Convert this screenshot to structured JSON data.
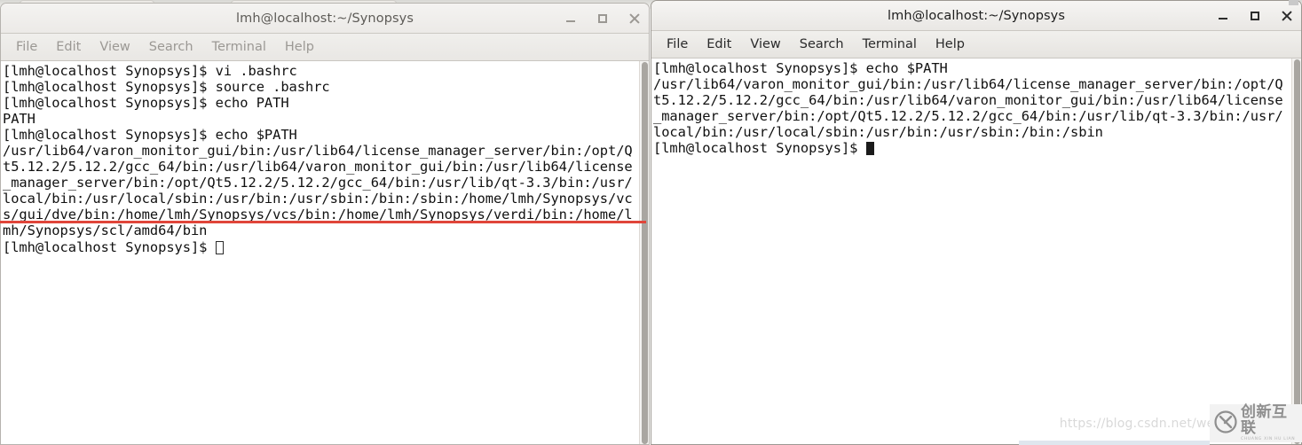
{
  "background_tabs": [
    {
      "label": ""
    },
    {
      "label": ""
    },
    {
      "label": ""
    },
    {
      "label": ""
    }
  ],
  "windows": {
    "left": {
      "title": "lmh@localhost:~/Synopsys",
      "active": false,
      "menu": [
        "File",
        "Edit",
        "View",
        "Search",
        "Terminal",
        "Help"
      ],
      "window_buttons": {
        "minimize": "minimize-icon",
        "maximize": "maximize-icon",
        "close": "close-icon"
      },
      "terminal_text": "[lmh@localhost Synopsys]$ vi .bashrc\n[lmh@localhost Synopsys]$ source .bashrc\n[lmh@localhost Synopsys]$ echo PATH\nPATH\n[lmh@localhost Synopsys]$ echo $PATH\n/usr/lib64/varon_monitor_gui/bin:/usr/lib64/license_manager_server/bin:/opt/Qt5.12.2/5.12.2/gcc_64/bin:/usr/lib64/varon_monitor_gui/bin:/usr/lib64/license_manager_server/bin:/opt/Qt5.12.2/5.12.2/gcc_64/bin:/usr/lib/qt-3.3/bin:/usr/local/bin:/usr/local/sbin:/usr/bin:/usr/sbin:/bin:/sbin:/home/lmh/Synopsys/vcs/gui/dve/bin:/home/lmh/Synopsys/vcs/bin:/home/lmh/Synopsys/verdi/bin:/home/lmh/Synopsys/scl/amd64/bin\n[lmh@localhost Synopsys]$ ",
      "cursor_style": "hollow"
    },
    "right": {
      "title": "lmh@localhost:~/Synopsys",
      "active": true,
      "menu": [
        "File",
        "Edit",
        "View",
        "Search",
        "Terminal",
        "Help"
      ],
      "window_buttons": {
        "minimize": "minimize-icon",
        "maximize": "maximize-icon",
        "close": "close-icon"
      },
      "terminal_text": "[lmh@localhost Synopsys]$ echo $PATH\n/usr/lib64/varon_monitor_gui/bin:/usr/lib64/license_manager_server/bin:/opt/Qt5.12.2/5.12.2/gcc_64/bin:/usr/lib64/varon_monitor_gui/bin:/usr/lib64/license_manager_server/bin:/opt/Qt5.12.2/5.12.2/gcc_64/bin:/usr/lib/qt-3.3/bin:/usr/local/bin:/usr/local/sbin:/usr/bin:/usr/sbin:/bin:/sbin\n[lmh@localhost Synopsys]$ ",
      "cursor_style": "solid"
    }
  },
  "annotation": {
    "type": "red-underline",
    "color": "#e0453a",
    "targets_line": "/amd64/bin"
  },
  "watermark": {
    "url": "https://blog.csdn.net/weix",
    "logo_text": "创新互联",
    "logo_subtext": "CHUANG XIN HU LIAN"
  },
  "colors": {
    "annotation_red": "#e0453a",
    "terminal_bg": "#ffffff",
    "terminal_fg": "#111111",
    "titlebar_bg": "#efeeeb",
    "scrollbar_thumb": "#a9a6a1"
  }
}
